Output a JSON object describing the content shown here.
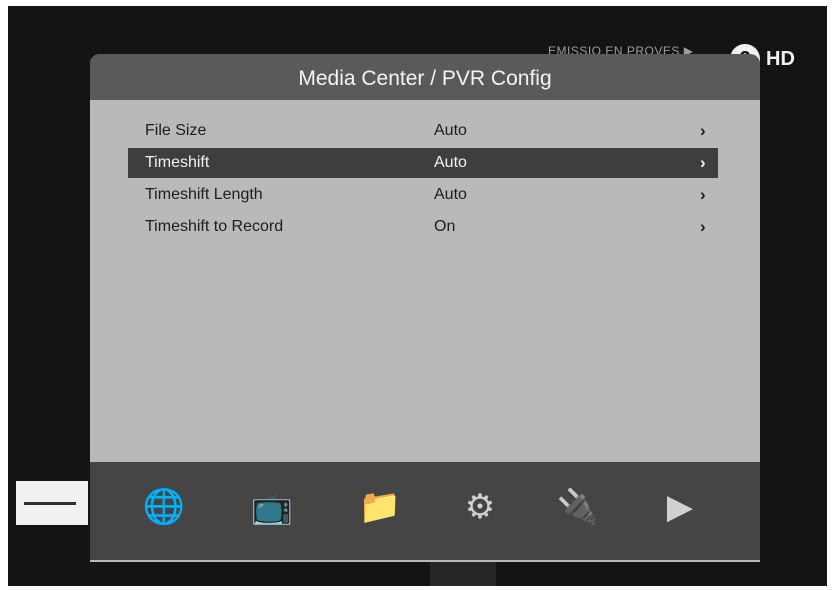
{
  "status": {
    "channel_info": "EMISSIO EN PROVES ▶"
  },
  "logo": {
    "circle": "2",
    "label": "HD"
  },
  "window": {
    "title": "Media Center / PVR Config"
  },
  "settings": [
    {
      "label": "File Size",
      "value": "Auto",
      "arrow": "›"
    },
    {
      "label": "Timeshift",
      "value": "Auto",
      "arrow": "›"
    },
    {
      "label": "Timeshift Length",
      "value": "Auto",
      "arrow": "›"
    },
    {
      "label": "Timeshift to Record",
      "value": "On",
      "arrow": "›"
    }
  ],
  "dock": [
    {
      "icon": "globe-icon",
      "glyph": "🌐"
    },
    {
      "icon": "tv-icon",
      "glyph": "📺"
    },
    {
      "icon": "media-icon",
      "glyph": "📁"
    },
    {
      "icon": "gear-icon",
      "glyph": "⚙"
    },
    {
      "icon": "plug-icon",
      "glyph": "🔌"
    },
    {
      "icon": "play-icon",
      "glyph": "▶"
    }
  ]
}
